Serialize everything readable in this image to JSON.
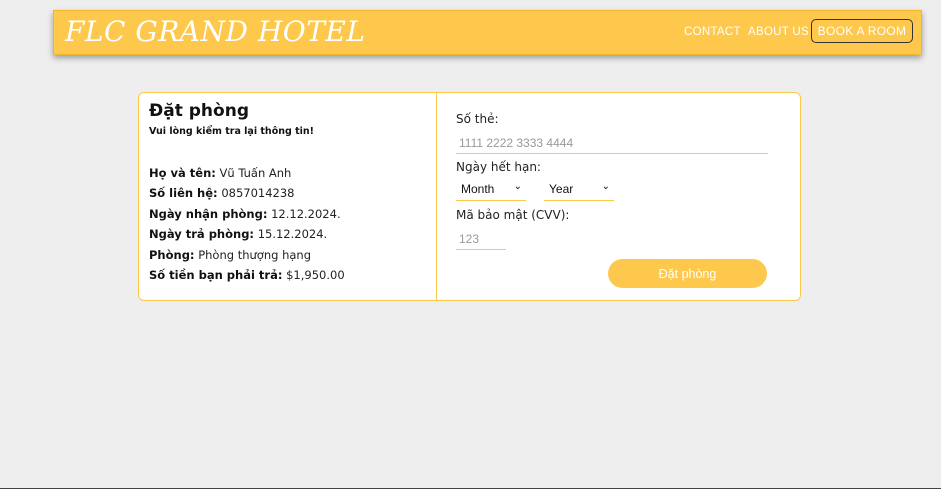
{
  "navbar": {
    "brand": "FLC GRAND HOTEL",
    "links": {
      "contact": "CONTACT",
      "about": "ABOUT US",
      "book": "BOOK A ROOM"
    }
  },
  "summary": {
    "title": "Đặt phòng",
    "subtitle": "Vui lòng kiểm tra lại thông tin!",
    "rows": [
      {
        "label": "Họ và tên:",
        "value": "Vũ Tuấn Anh"
      },
      {
        "label": "Số liên hệ:",
        "value": "0857014238"
      },
      {
        "label": "Ngày nhận phòng:",
        "value": "12.12.2024."
      },
      {
        "label": "Ngày trả phòng:",
        "value": "15.12.2024."
      },
      {
        "label": "Phòng:",
        "value": "Phòng thượng hạng"
      },
      {
        "label": "Số tiền bạn phải trả:",
        "value": "$1,950.00"
      }
    ]
  },
  "payment": {
    "card_label": "Số thẻ:",
    "card_placeholder": "1111 2222 3333 4444",
    "expiry_label": "Ngày hết hạn:",
    "month_value": "Month",
    "year_value": "Year",
    "cvv_label": "Mã bảo mật (CVV):",
    "cvv_placeholder": "123",
    "submit_label": "Đặt phòng"
  },
  "colors": {
    "accent": "#fec84c",
    "border": "#fdc94b",
    "background": "#eeeeee"
  }
}
